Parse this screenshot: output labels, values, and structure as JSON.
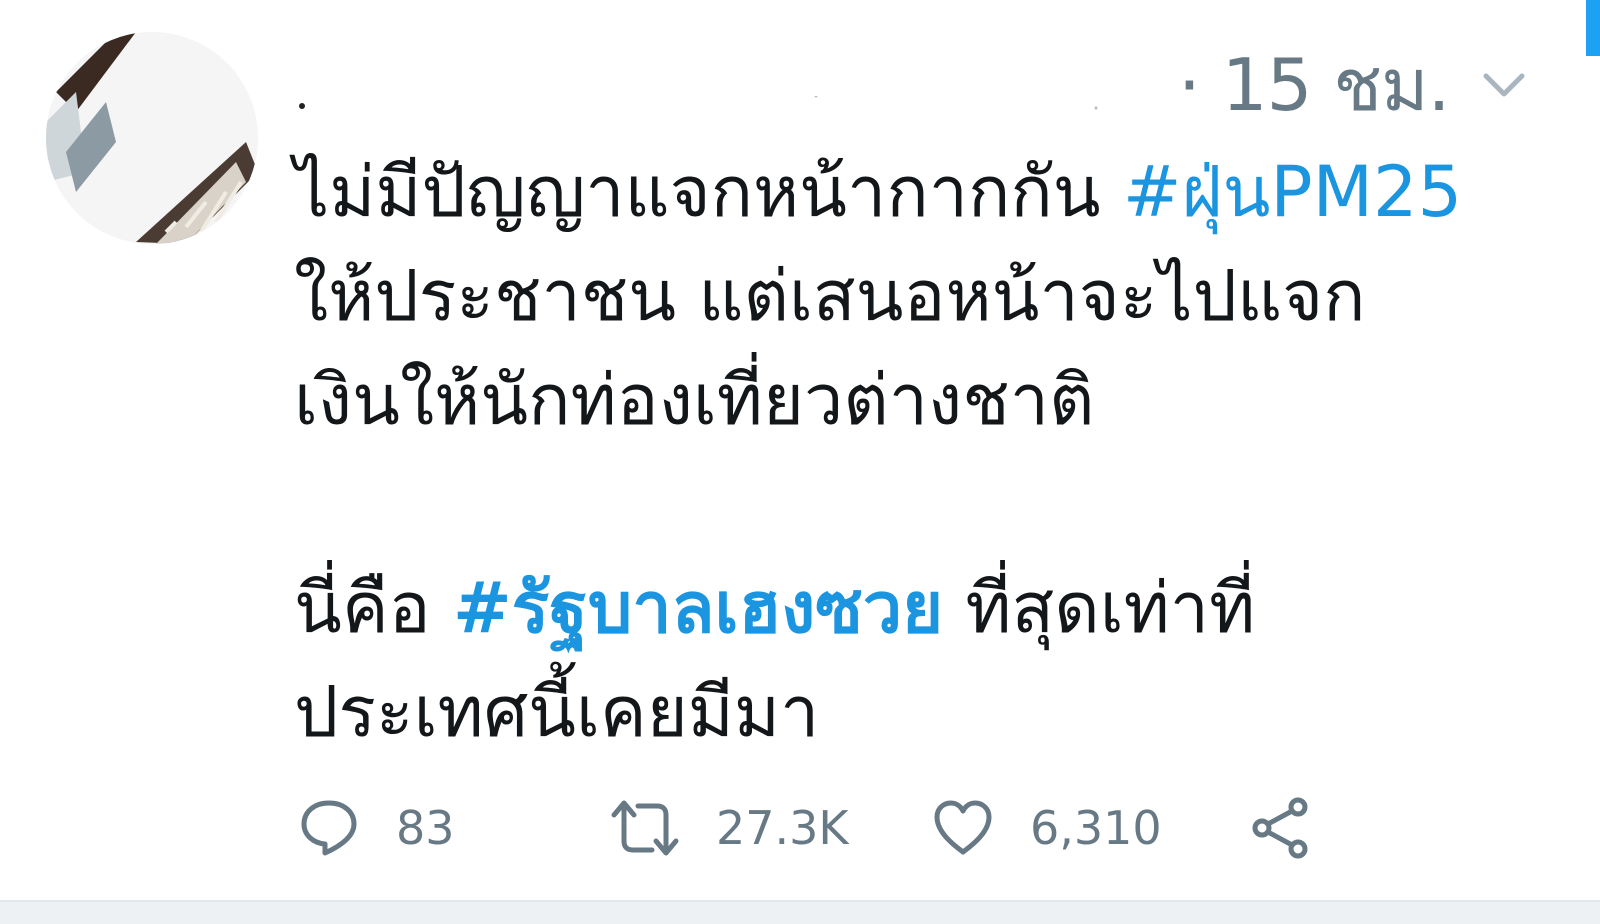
{
  "tweet": {
    "timestamp": "· 15 ชม.",
    "text": {
      "line1_plain": "ไม่มีปัญญาแจกหน้ากากกัน ",
      "line1_hashtag": "#ฝุ่นPM25",
      "line2": "ให้ประชาชน แต่เสนอหน้าจะไปแจก",
      "line3": "เงินให้นักท่องเที่ยวต่างชาติ",
      "line4_prefix": "นี่คือ ",
      "line4_hashtag": "#รัฐบาลเฮงซวย",
      "line4_suffix": " ที่สุดเท่าที่",
      "line5": "ประเทศนี้เคยมีมา"
    },
    "actions": {
      "reply_count": "83",
      "retweet_count": "27.3K",
      "like_count": "6,310"
    }
  },
  "colors": {
    "hashtag": "#1b95e0",
    "text": "#14171a",
    "muted": "#687986",
    "accent": "#1da1f2"
  },
  "icons": {
    "avatar": "avatar-image",
    "caret": "chevron-down-icon",
    "reply": "reply-icon",
    "retweet": "retweet-icon",
    "like": "heart-icon",
    "share": "share-icon"
  }
}
